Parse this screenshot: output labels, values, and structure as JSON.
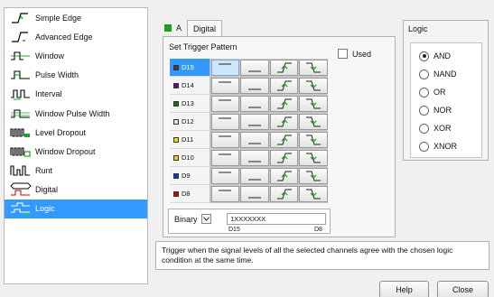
{
  "trigger_types": [
    {
      "label": "Simple Edge",
      "icon": "simple-edge-icon"
    },
    {
      "label": "Advanced Edge",
      "icon": "advanced-edge-icon"
    },
    {
      "label": "Window",
      "icon": "window-icon"
    },
    {
      "label": "Pulse Width",
      "icon": "pulse-width-icon"
    },
    {
      "label": "Interval",
      "icon": "interval-icon"
    },
    {
      "label": "Window Pulse Width",
      "icon": "window-pulse-width-icon"
    },
    {
      "label": "Level Dropout",
      "icon": "level-dropout-icon"
    },
    {
      "label": "Window Dropout",
      "icon": "window-dropout-icon"
    },
    {
      "label": "Runt",
      "icon": "runt-icon"
    },
    {
      "label": "Digital",
      "icon": "digital-icon"
    },
    {
      "label": "Logic",
      "icon": "logic-icon"
    }
  ],
  "selected_trigger": 10,
  "tabs": [
    {
      "label": "A"
    },
    {
      "label": "Digital"
    }
  ],
  "pattern": {
    "title": "Set Trigger Pattern",
    "used_label": "Used",
    "channels": [
      {
        "name": "D15",
        "color": "#404040"
      },
      {
        "name": "D14",
        "color": "#800080"
      },
      {
        "name": "D13",
        "color": "#008000"
      },
      {
        "name": "D12",
        "color": "#e0e0e0"
      },
      {
        "name": "D11",
        "color": "#f0e000"
      },
      {
        "name": "D10",
        "color": "#f0d000"
      },
      {
        "name": "D9",
        "color": "#0040c0"
      },
      {
        "name": "D8",
        "color": "#d00000"
      }
    ]
  },
  "format": {
    "type": "Binary",
    "value": "1XXXXXXX",
    "range_high": "D15",
    "range_low": "D8"
  },
  "logic": {
    "title": "Logic",
    "options": [
      "AND",
      "NAND",
      "OR",
      "NOR",
      "XOR",
      "XNOR"
    ],
    "selected": "AND"
  },
  "description": "Trigger when the signal levels of all the selected channels agree with the chosen logic condition at the same time.",
  "buttons": {
    "help": "Help",
    "close": "Close"
  },
  "colors": {
    "selection": "#3399ff",
    "tab_check": "#1da11d",
    "edge_green": "#21a121"
  }
}
